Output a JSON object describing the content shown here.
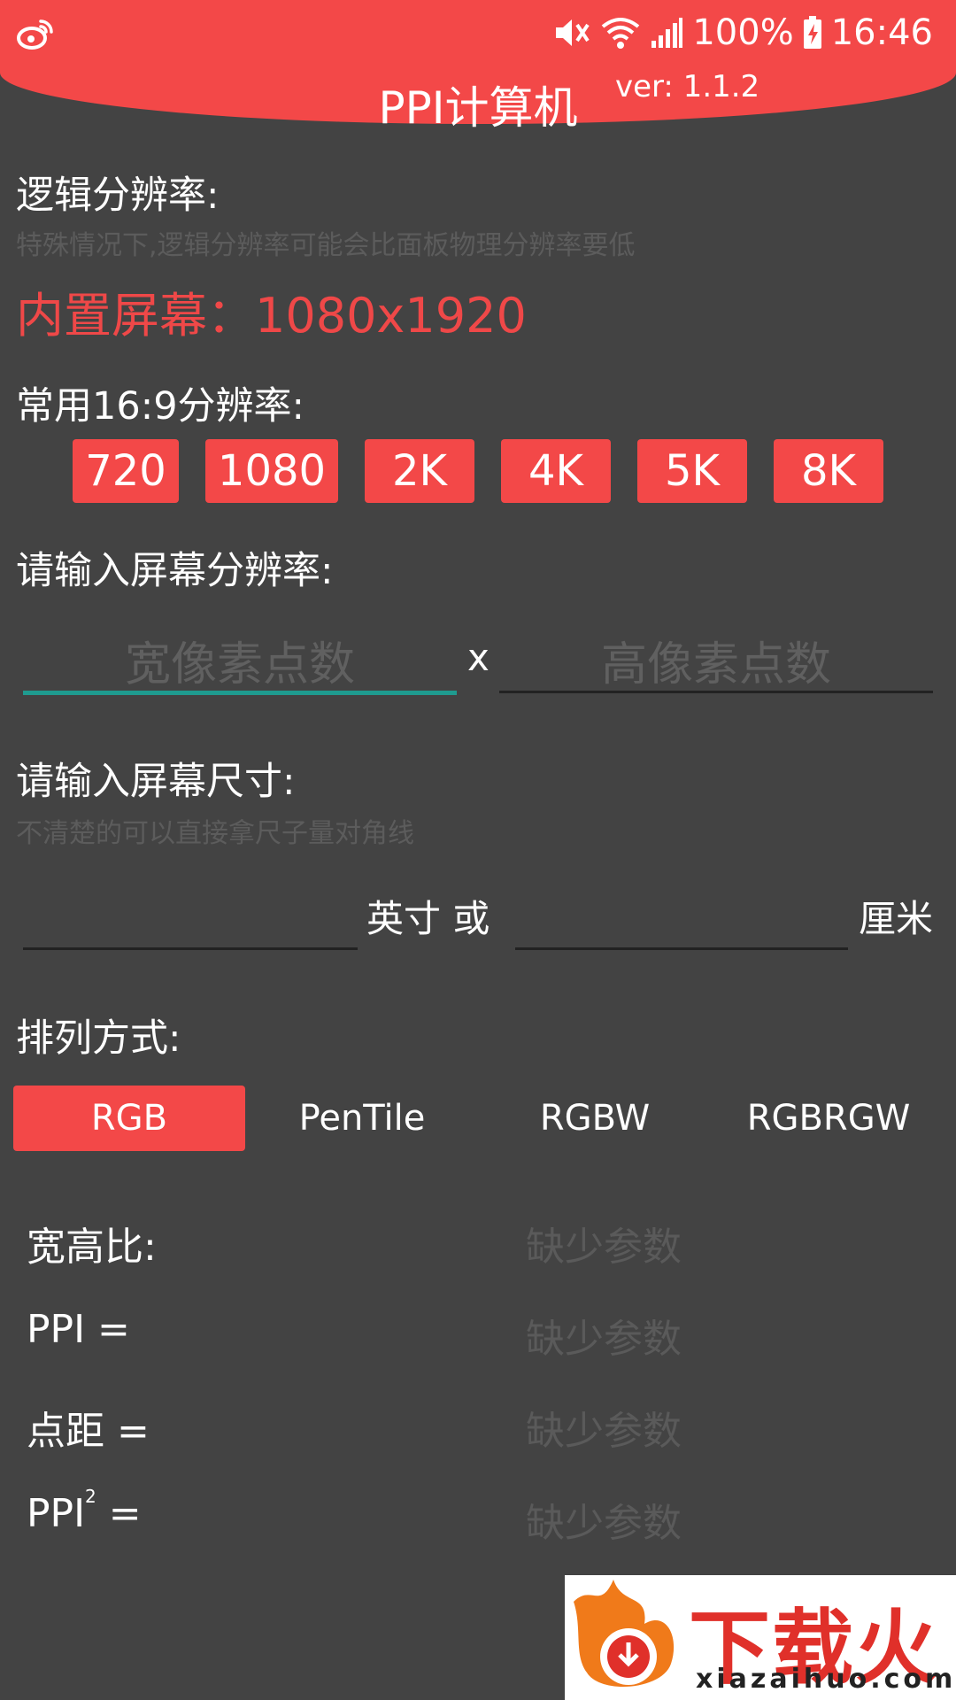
{
  "status": {
    "battery_percent": "100%",
    "time": "16:46"
  },
  "header": {
    "title": "PPI计算机",
    "version": "ver: 1.1.2"
  },
  "logical": {
    "label": "逻辑分辨率:",
    "hint": "特殊情况下,逻辑分辨率可能会比面板物理分辨率要低",
    "builtin": "内置屏幕：1080x1920"
  },
  "common": {
    "label": "常用16:9分辨率:",
    "buttons": [
      "720",
      "1080",
      "2K",
      "4K",
      "5K",
      "8K"
    ]
  },
  "resolution_input": {
    "label": "请输入屏幕分辨率:",
    "width_placeholder": "宽像素点数",
    "separator": "x",
    "height_placeholder": "高像素点数"
  },
  "size_input": {
    "label": "请输入屏幕尺寸:",
    "hint": "不清楚的可以直接拿尺子量对角线",
    "inch_unit": "英寸 或",
    "cm_unit": "厘米"
  },
  "arrangement": {
    "label": "排列方式:",
    "options": [
      "RGB",
      "PenTile",
      "RGBW",
      "RGBRGW"
    ],
    "selected": "RGB"
  },
  "results": {
    "aspect_label": "宽高比:",
    "ppi_label": "PPI =",
    "pitch_label": "点距 =",
    "ppi2_label_base": "PPI",
    "ppi2_label_sup": "2",
    "ppi2_label_eq": "=",
    "missing": "缺少参数"
  },
  "watermark": {
    "brand": "下载火",
    "url": "xiazaihuo.com"
  },
  "colors": {
    "accent": "#f34848",
    "background": "#434343",
    "focus_underline": "#1f9b8f"
  }
}
